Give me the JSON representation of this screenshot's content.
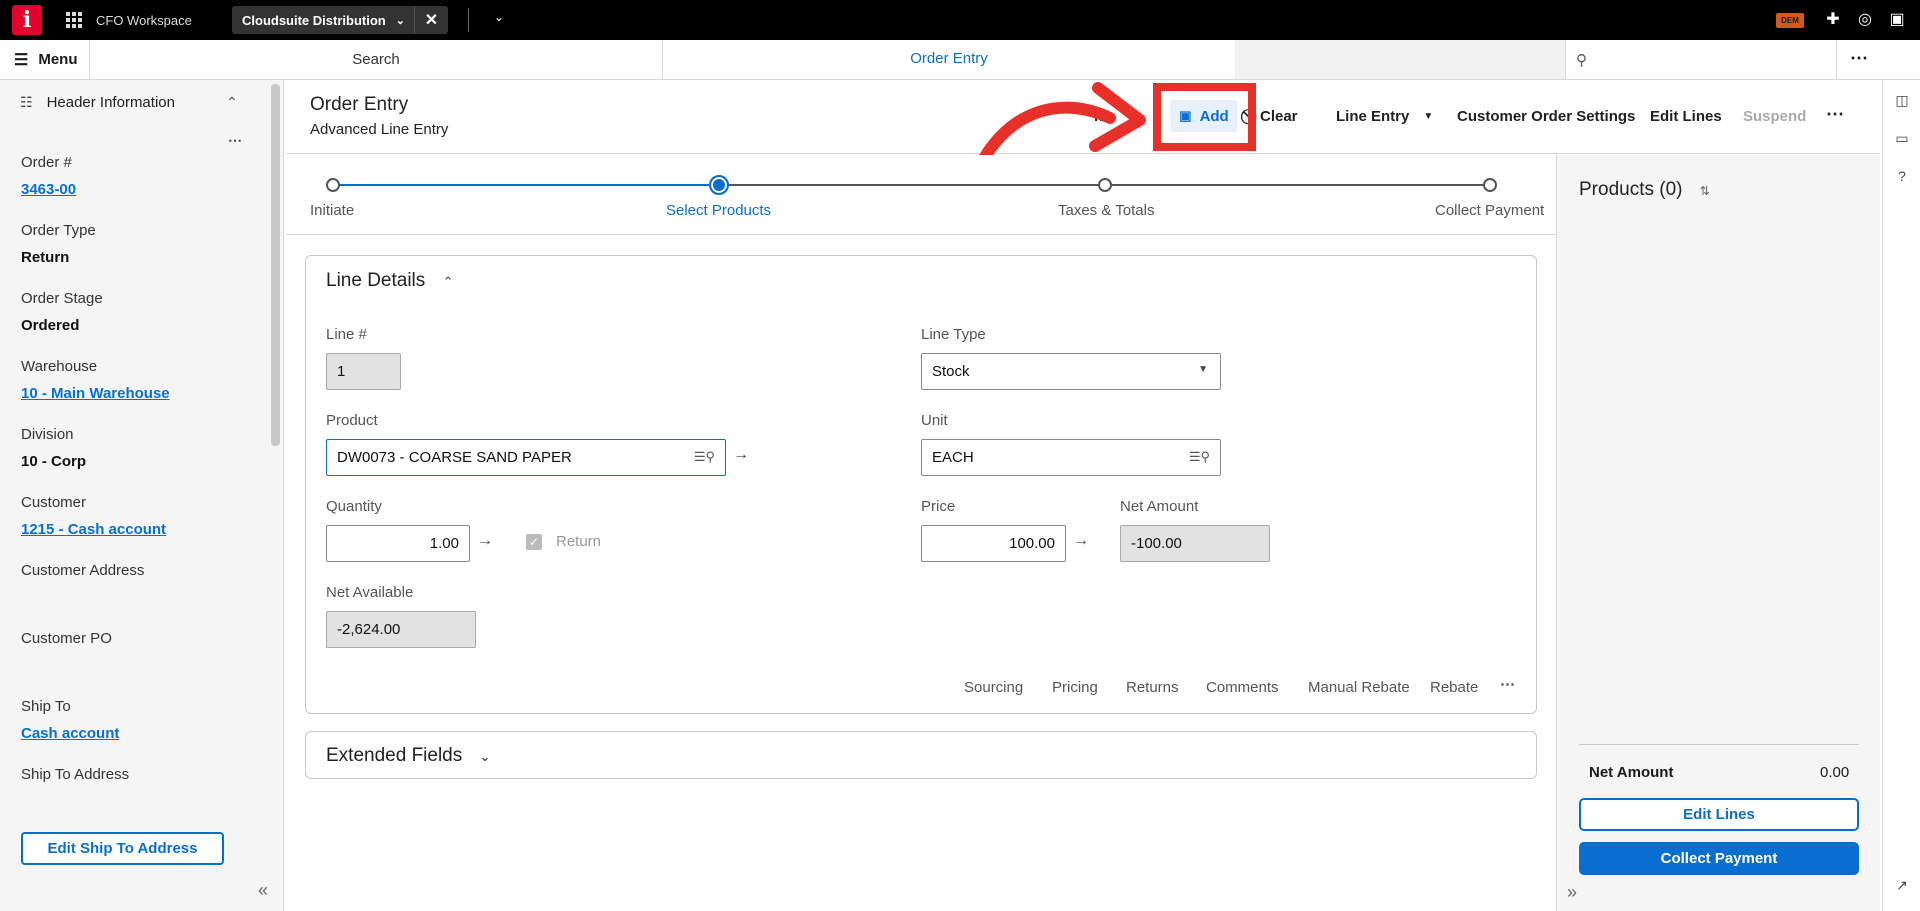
{
  "topbar": {
    "logo": "i",
    "workspace": "CFO Workspace",
    "app_tab": "Cloudsuite Distribution",
    "badge": "DEM"
  },
  "nav": {
    "menu": "Menu",
    "search_tab": "Search",
    "order_tab": "Order Entry"
  },
  "sidebar": {
    "header": "Header Information",
    "fields": [
      {
        "label": "Order #",
        "value": "3463-00",
        "link": true
      },
      {
        "label": "Order Type",
        "value": "Return",
        "link": false
      },
      {
        "label": "Order Stage",
        "value": "Ordered",
        "link": false
      },
      {
        "label": "Warehouse",
        "value": "10 - Main Warehouse",
        "link": true
      },
      {
        "label": "Division",
        "value": "10 - Corp",
        "link": false
      },
      {
        "label": "Customer",
        "value": "1215 - Cash account",
        "link": true
      },
      {
        "label": "Customer Address",
        "value": "",
        "link": false
      },
      {
        "label": "Customer PO",
        "value": "",
        "link": false
      },
      {
        "label": "Ship To",
        "value": "Cash account",
        "link": true
      },
      {
        "label": "Ship To Address",
        "value": "",
        "link": false
      }
    ],
    "edit_ship_button": "Edit Ship To Address"
  },
  "main": {
    "title": "Order Entry",
    "subtitle": "Advanced Line Entry",
    "toolbar": {
      "partial": "n",
      "add": "Add",
      "clear": "Clear",
      "line_entry": "Line Entry",
      "customer_settings": "Customer Order Settings",
      "edit_lines": "Edit Lines",
      "suspend": "Suspend"
    }
  },
  "stepper": {
    "steps": [
      "Initiate",
      "Select Products",
      "Taxes & Totals",
      "Collect Payment"
    ],
    "active_index": 1
  },
  "line_details": {
    "title": "Line Details",
    "line_no_label": "Line #",
    "line_no": "1",
    "line_type_label": "Line Type",
    "line_type": "Stock",
    "product_label": "Product",
    "product": "DW0073 - COARSE SAND PAPER",
    "unit_label": "Unit",
    "unit": "EACH",
    "quantity_label": "Quantity",
    "quantity": "1.00",
    "return_label": "Return",
    "price_label": "Price",
    "price": "100.00",
    "net_amount_label": "Net Amount",
    "net_amount": "-100.00",
    "net_available_label": "Net Available",
    "net_available": "-2,624.00",
    "links": [
      "Sourcing",
      "Pricing",
      "Returns",
      "Comments",
      "Manual Rebate",
      "Rebate"
    ]
  },
  "extended_fields": {
    "title": "Extended Fields"
  },
  "products_panel": {
    "title": "Products (0)",
    "net_amount_label": "Net Amount",
    "net_amount": "0.00",
    "edit_lines": "Edit Lines",
    "collect_payment": "Collect Payment"
  },
  "colors": {
    "accent": "#0a6ed1",
    "brand": "#e4032e",
    "annotation": "#e8302a"
  }
}
